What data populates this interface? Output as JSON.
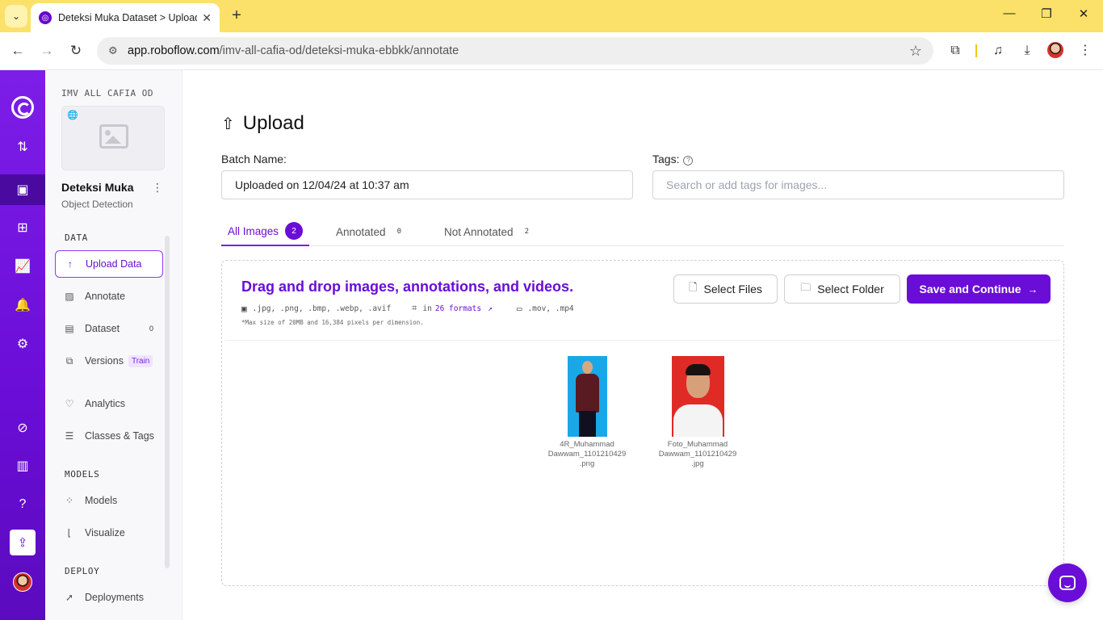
{
  "browser": {
    "tab_title": "Deteksi Muka Dataset > Upload",
    "url_host": "app.roboflow.com",
    "url_path": "/imv-all-cafia-od/deteksi-muka-ebbkk/annotate"
  },
  "sidebar": {
    "workspace_name": "IMV ALL CAFIA OD",
    "project_name": "Deteksi Muka",
    "project_type": "Object Detection",
    "sections": {
      "data": "DATA",
      "models": "MODELS",
      "deploy": "DEPLOY"
    },
    "items": [
      {
        "label": "Upload Data",
        "icon": "upload-icon"
      },
      {
        "label": "Annotate",
        "icon": "annotate-icon"
      },
      {
        "label": "Dataset",
        "icon": "dataset-icon",
        "count": "0"
      },
      {
        "label": "Versions",
        "icon": "versions-icon",
        "badge": "Train"
      },
      {
        "label": "Analytics",
        "icon": "analytics-icon"
      },
      {
        "label": "Classes & Tags",
        "icon": "list-icon"
      },
      {
        "label": "Models",
        "icon": "models-icon"
      },
      {
        "label": "Visualize",
        "icon": "visualize-icon"
      },
      {
        "label": "Deployments",
        "icon": "rocket-icon"
      }
    ]
  },
  "main": {
    "title": "Upload",
    "batch_label": "Batch Name:",
    "batch_value": "Uploaded on 12/04/24 at 10:37 am",
    "tags_label": "Tags:",
    "tags_placeholder": "Search or add tags for images...",
    "tabs": [
      {
        "label": "All Images",
        "count": "2"
      },
      {
        "label": "Annotated",
        "count": "0"
      },
      {
        "label": "Not Annotated",
        "count": "2"
      }
    ],
    "dropzone": {
      "title": "Drag and drop images, annotations, and videos.",
      "image_types": ".jpg, .png, .bmp, .webp, .avif",
      "annotation_prefix": "in",
      "annotation_link": "26 formats",
      "video_types": ".mov, .mp4",
      "note": "*Max size of 20MB and 16,384 pixels per dimension.",
      "select_files": "Select Files",
      "select_folder": "Select Folder",
      "save_continue": "Save and Continue"
    },
    "files": [
      {
        "line1": "4R_Muhammad",
        "line2": "Dawwam_1101210429",
        "line3": ".png"
      },
      {
        "line1": "Foto_Muhammad",
        "line2": "Dawwam_1101210429",
        "line3": ".jpg"
      }
    ]
  },
  "colors": {
    "accent": "#6a0dd6",
    "tabbar": "#fbe16a"
  }
}
